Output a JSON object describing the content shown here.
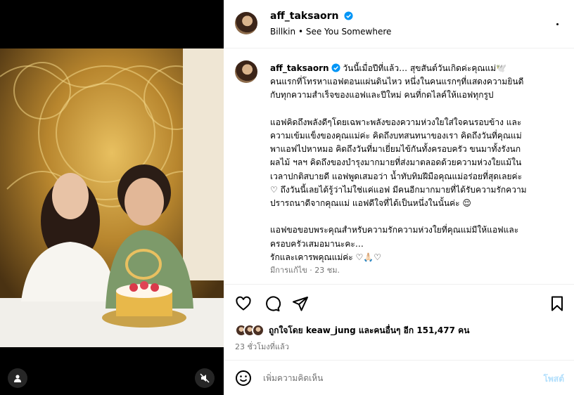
{
  "post": {
    "username": "aff_taksaorn",
    "music": "Billkin • See You Somewhere",
    "caption": {
      "username": "aff_taksaorn",
      "text": "วันนี้เมื่อปีที่แล้ว… สุขสันต์วันเกิดค่ะคุณแม่🕊️\nคนแรกที่โทรหาแอฟตอนแผ่นดินไหว หนึ่งในคนแรกๆที่แสดงความยินดี\nกับทุกความสำเร็จของแอฟและปีใหม่ คนที่กดไลค์ให้แอฟทุกรูป\n\nแอฟคิดถึงพลังดีๆโดยเฉพาะพลังของความห่วงใยใส่ใจคนรอบข้าง และ\nความเข้มแข็งของคุณแม่ค่ะ คิดถึงบทสนทนาของเรา คิดถึงวันที่คุณแม่\nพาแอฟไปหาหมอ คิดถึงวันที่มาเยี่ยมไข้กันทั้งครอบครัว ขนมาทั้งรังนก\nผลไม้ ฯลฯ คิดถึงของบำรุงมากมายที่ส่งมาตลอดด้วยความห่วงใยแม้ใน\nเวลาปกติสบายดี แอฟพูดเสมอว่า น้ำทับทิมฝีมือคุณแม่อร่อยที่สุดเลยค่ะ\n♡ ถึงวันนี้เลยได้รู้ว่าไม่ใช่แค่แอฟ มีคนอีกมากมายที่ได้รับความรักความ\nปรารถนาดีจากคุณแม่ แอฟดีใจที่ได้เป็นหนึ่งในนั้นค่ะ 😌\n\nแอฟขอขอบพระคุณสำหรับความรักความห่วงใยที่คุณแม่มีให้แอฟและ\nครอบครัวเสมอมานะคะ…\nรักและเคารพคุณแม่ค่ะ ♡🙏🏻♡"
    },
    "edited_label": "มีการแก้ไข · 23 ชม.",
    "likes": {
      "prefix": "ถูกใจโดย",
      "user": "keaw_jung",
      "middle": "และคนอื่นๆ อีก",
      "count": "151,477",
      "suffix": "คน"
    },
    "time_ago": "23 ชั่วโมงที่แล้ว"
  },
  "comment": {
    "placeholder": "เพิ่มความคิดเห็น",
    "post_label": "โพสต์"
  },
  "icons": {
    "verified": "verified-badge-icon",
    "more": "more-options-icon",
    "like": "heart-icon",
    "comment": "comment-icon",
    "share": "paper-plane-icon",
    "save": "bookmark-icon",
    "emoji": "emoji-icon",
    "user_tag": "user-tag-icon",
    "mute": "speaker-muted-icon"
  },
  "colors": {
    "verified": "#0095f6",
    "muted_text": "#737373",
    "post_disabled": "#b2dffc"
  }
}
